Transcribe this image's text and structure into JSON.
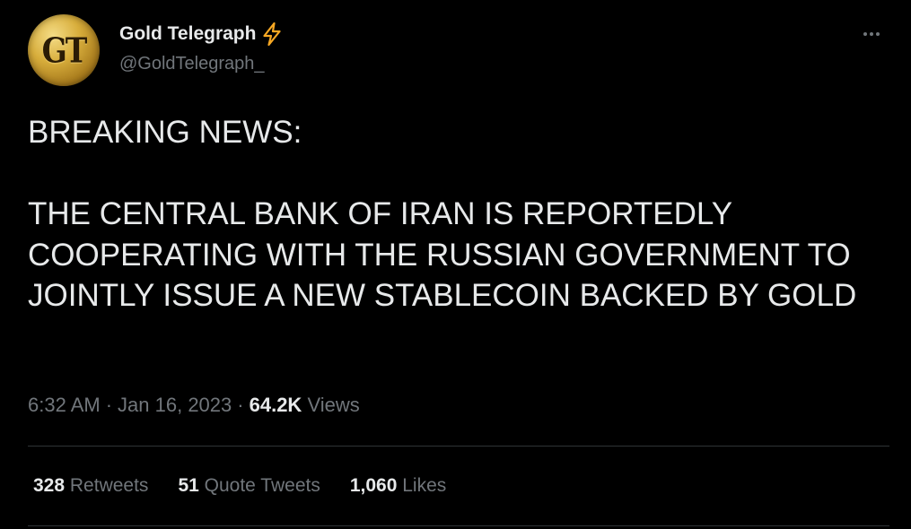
{
  "author": {
    "display_name": "Gold Telegraph",
    "verified_badge_icon": "lightning-bolt-icon",
    "handle": "@GoldTelegraph_",
    "avatar_text": "GT",
    "avatar_color": "#d8ae3c"
  },
  "tweet": {
    "headline": "BREAKING NEWS:",
    "body": "THE CENTRAL BANK OF IRAN IS REPORTEDLY COOPERATING WITH THE RUSSIAN GOVERNMENT TO JOINTLY ISSUE A NEW STABLECOIN BACKED BY GOLD"
  },
  "meta": {
    "time": "6:32 AM",
    "date": "Jan 16, 2023",
    "separator": "·",
    "views_count": "64.2K",
    "views_label": "Views"
  },
  "stats": {
    "retweets_count": "328",
    "retweets_label": "Retweets",
    "quote_tweets_count": "51",
    "quote_tweets_label": "Quote Tweets",
    "likes_count": "1,060",
    "likes_label": "Likes"
  },
  "colors": {
    "background": "#000000",
    "primary_text": "#e7e9ea",
    "secondary_text": "#71767b",
    "divider": "#2f3336",
    "bolt": "#f7a823"
  },
  "icons": {
    "more": "more-horizontal-icon"
  }
}
